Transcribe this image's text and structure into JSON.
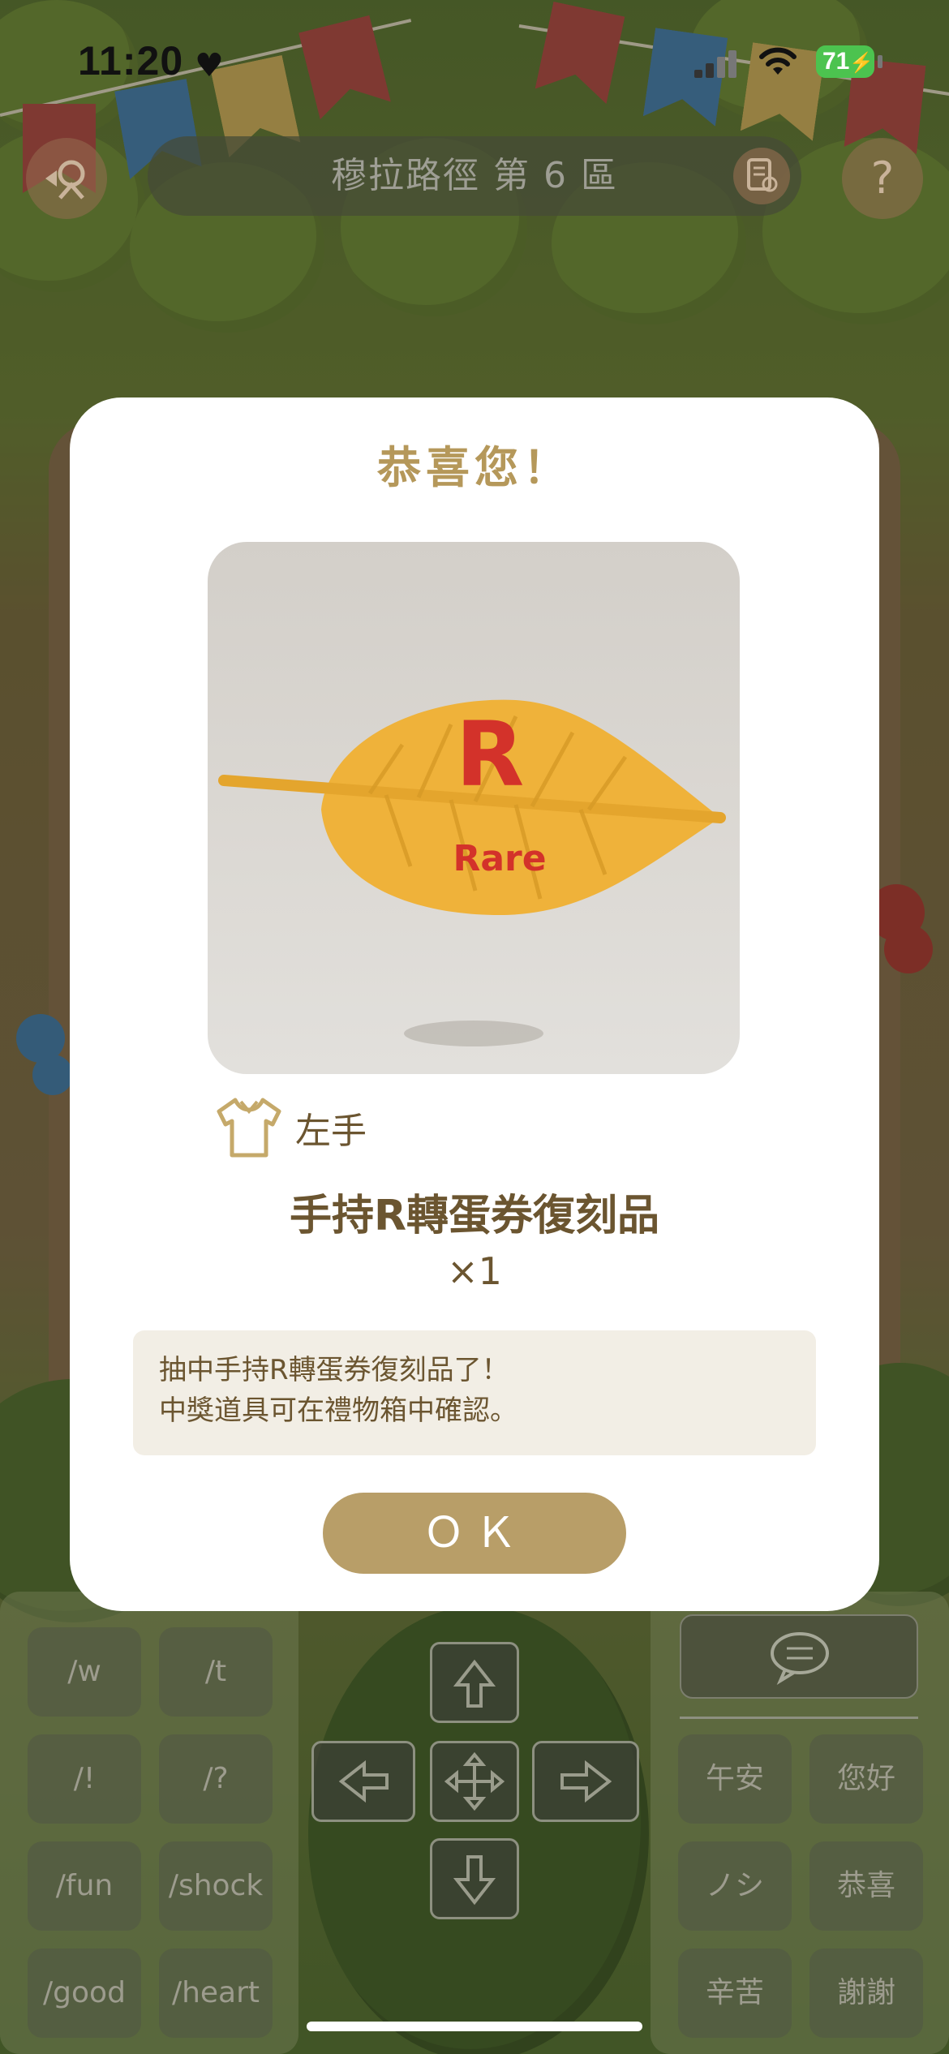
{
  "status_bar": {
    "time": "11:20",
    "battery": "71"
  },
  "location_bar": {
    "title": "穆拉路徑 第 6 區"
  },
  "top_buttons": {
    "help": "?"
  },
  "emote_keys": [
    "/w",
    "/t",
    "/!",
    "/?",
    "/fun",
    "/shock",
    "/good",
    "/heart"
  ],
  "phrase_keys": [
    "午安",
    "您好",
    "ノシ",
    "恭喜",
    "辛苦",
    "謝謝"
  ],
  "modal": {
    "title": "恭喜您！",
    "slot_label": "左手",
    "item_name": "手持R轉蛋券復刻品",
    "quantity": "×1",
    "message_line1": "抽中手持R轉蛋券復刻品了！",
    "message_line2": "中獎道具可在禮物箱中確認。",
    "ok_label": "ＯＫ",
    "item_art_text": "R",
    "item_art_subtext": "Rare"
  },
  "colors": {
    "accent_gold": "#b89e68",
    "title_gold": "#b5985a",
    "text_brown": "#6b5530",
    "message_bg": "#f2eee5"
  }
}
